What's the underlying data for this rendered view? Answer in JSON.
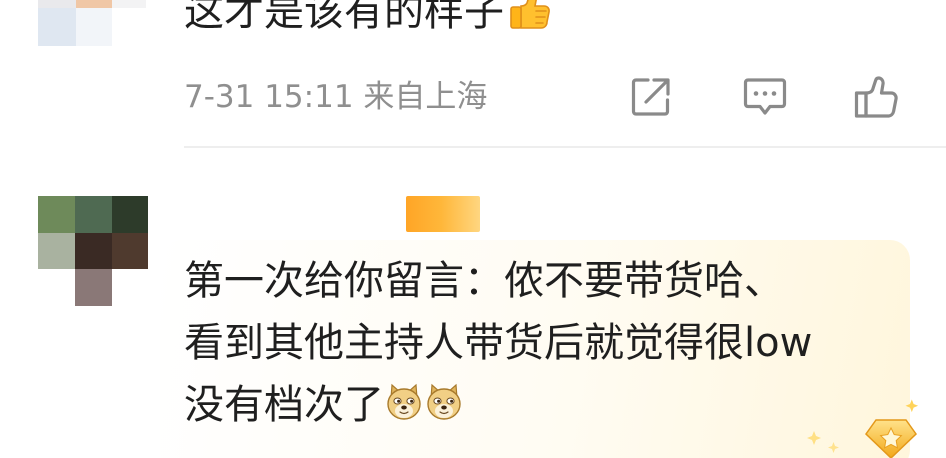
{
  "comments": [
    {
      "text": "这才是该有的样子",
      "emoji": "thumbs-up-icon",
      "date": "7-31 15:11",
      "location": "来自上海",
      "actions": [
        "share-icon",
        "reply-icon",
        "like-icon"
      ]
    },
    {
      "lines": [
        "第一次给你留言：侬不要带货哈、",
        "看到其他主持人带货后就觉得很low",
        "没有档次了"
      ],
      "emoji": "doge-icon",
      "badge": "star-badge-icon"
    }
  ],
  "colors": {
    "text": "#1f1f1f",
    "meta": "#8f8f8f",
    "icon": "#8a8a8a",
    "username_highlight": "#ffab2d",
    "bubble": "#fff6dc"
  }
}
